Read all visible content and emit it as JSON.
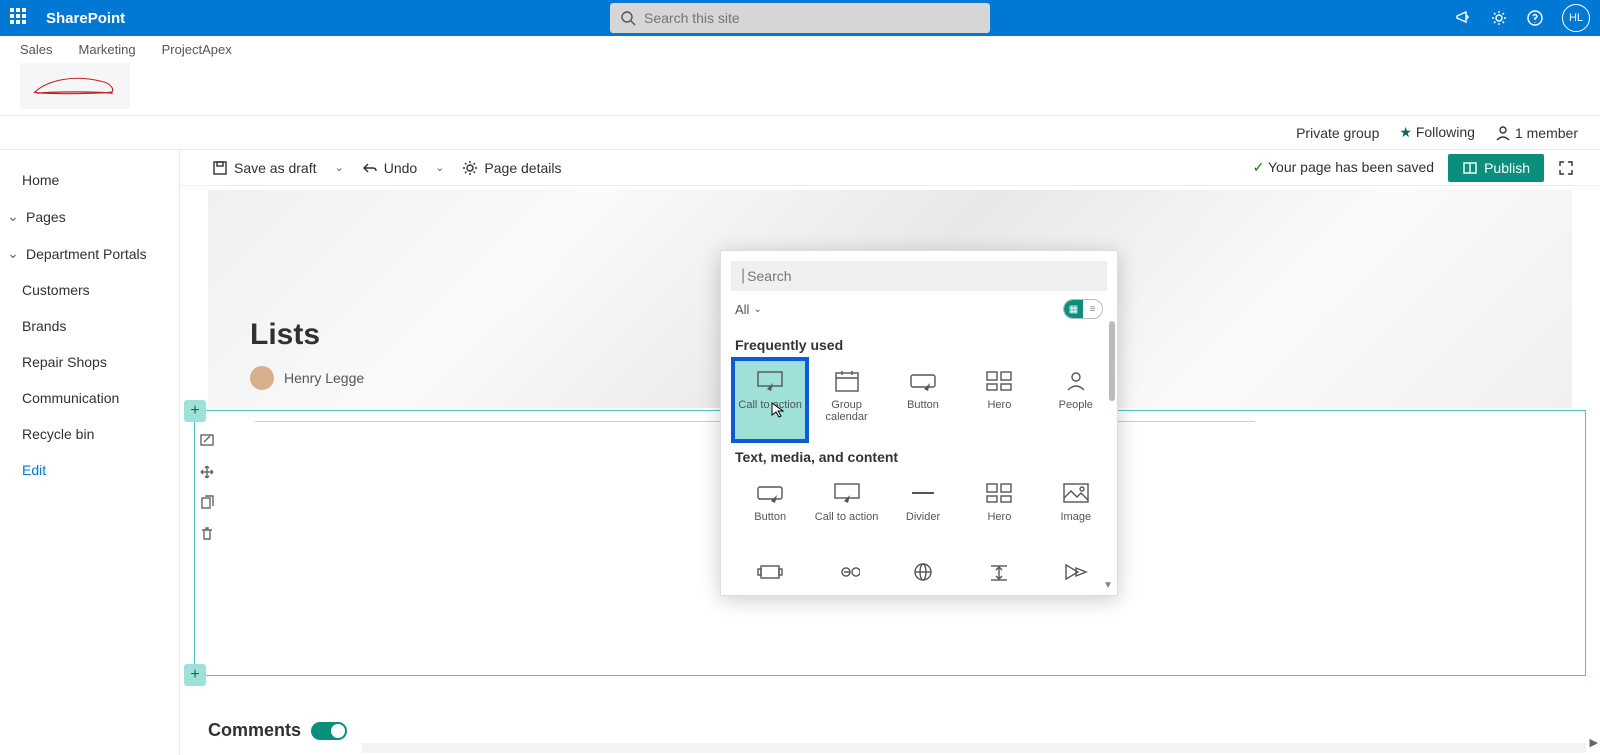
{
  "suite": {
    "app_name": "SharePoint",
    "search_placeholder": "Search this site",
    "avatar_initials": "HL"
  },
  "hub": {
    "links": [
      "Sales",
      "Marketing",
      "ProjectApex"
    ]
  },
  "site_info": {
    "group_type": "Private group",
    "follow_label": "Following",
    "members_label": "1 member"
  },
  "sidenav": {
    "items": [
      {
        "label": "Home",
        "type": "item"
      },
      {
        "label": "Pages",
        "type": "expander"
      },
      {
        "label": "Department Portals",
        "type": "expander"
      },
      {
        "label": "Customers",
        "type": "item"
      },
      {
        "label": "Brands",
        "type": "item"
      },
      {
        "label": "Repair Shops",
        "type": "item"
      },
      {
        "label": "Communication",
        "type": "item"
      },
      {
        "label": "Recycle bin",
        "type": "item"
      },
      {
        "label": "Edit",
        "type": "edit"
      }
    ]
  },
  "cmdbar": {
    "save_draft": "Save as draft",
    "undo": "Undo",
    "page_details": "Page details",
    "saved_msg": "Your page has been saved",
    "publish": "Publish"
  },
  "page": {
    "title": "Lists",
    "author": "Henry Legge",
    "comments_label": "Comments"
  },
  "picker": {
    "search_placeholder": "Search",
    "filter_all": "All",
    "section_frequent": "Frequently used",
    "section_text": "Text, media, and content",
    "frequent": [
      {
        "label": "Call to action",
        "icon": "cta"
      },
      {
        "label": "Group calendar",
        "icon": "calendar"
      },
      {
        "label": "Button",
        "icon": "button"
      },
      {
        "label": "Hero",
        "icon": "hero"
      },
      {
        "label": "People",
        "icon": "people"
      }
    ],
    "text_media": [
      {
        "label": "Button",
        "icon": "button"
      },
      {
        "label": "Call to action",
        "icon": "cta"
      },
      {
        "label": "Divider",
        "icon": "divider"
      },
      {
        "label": "Hero",
        "icon": "hero"
      },
      {
        "label": "Image",
        "icon": "image"
      }
    ],
    "row3_icons": [
      "gallery",
      "link",
      "embed",
      "spacer",
      "stream"
    ]
  }
}
